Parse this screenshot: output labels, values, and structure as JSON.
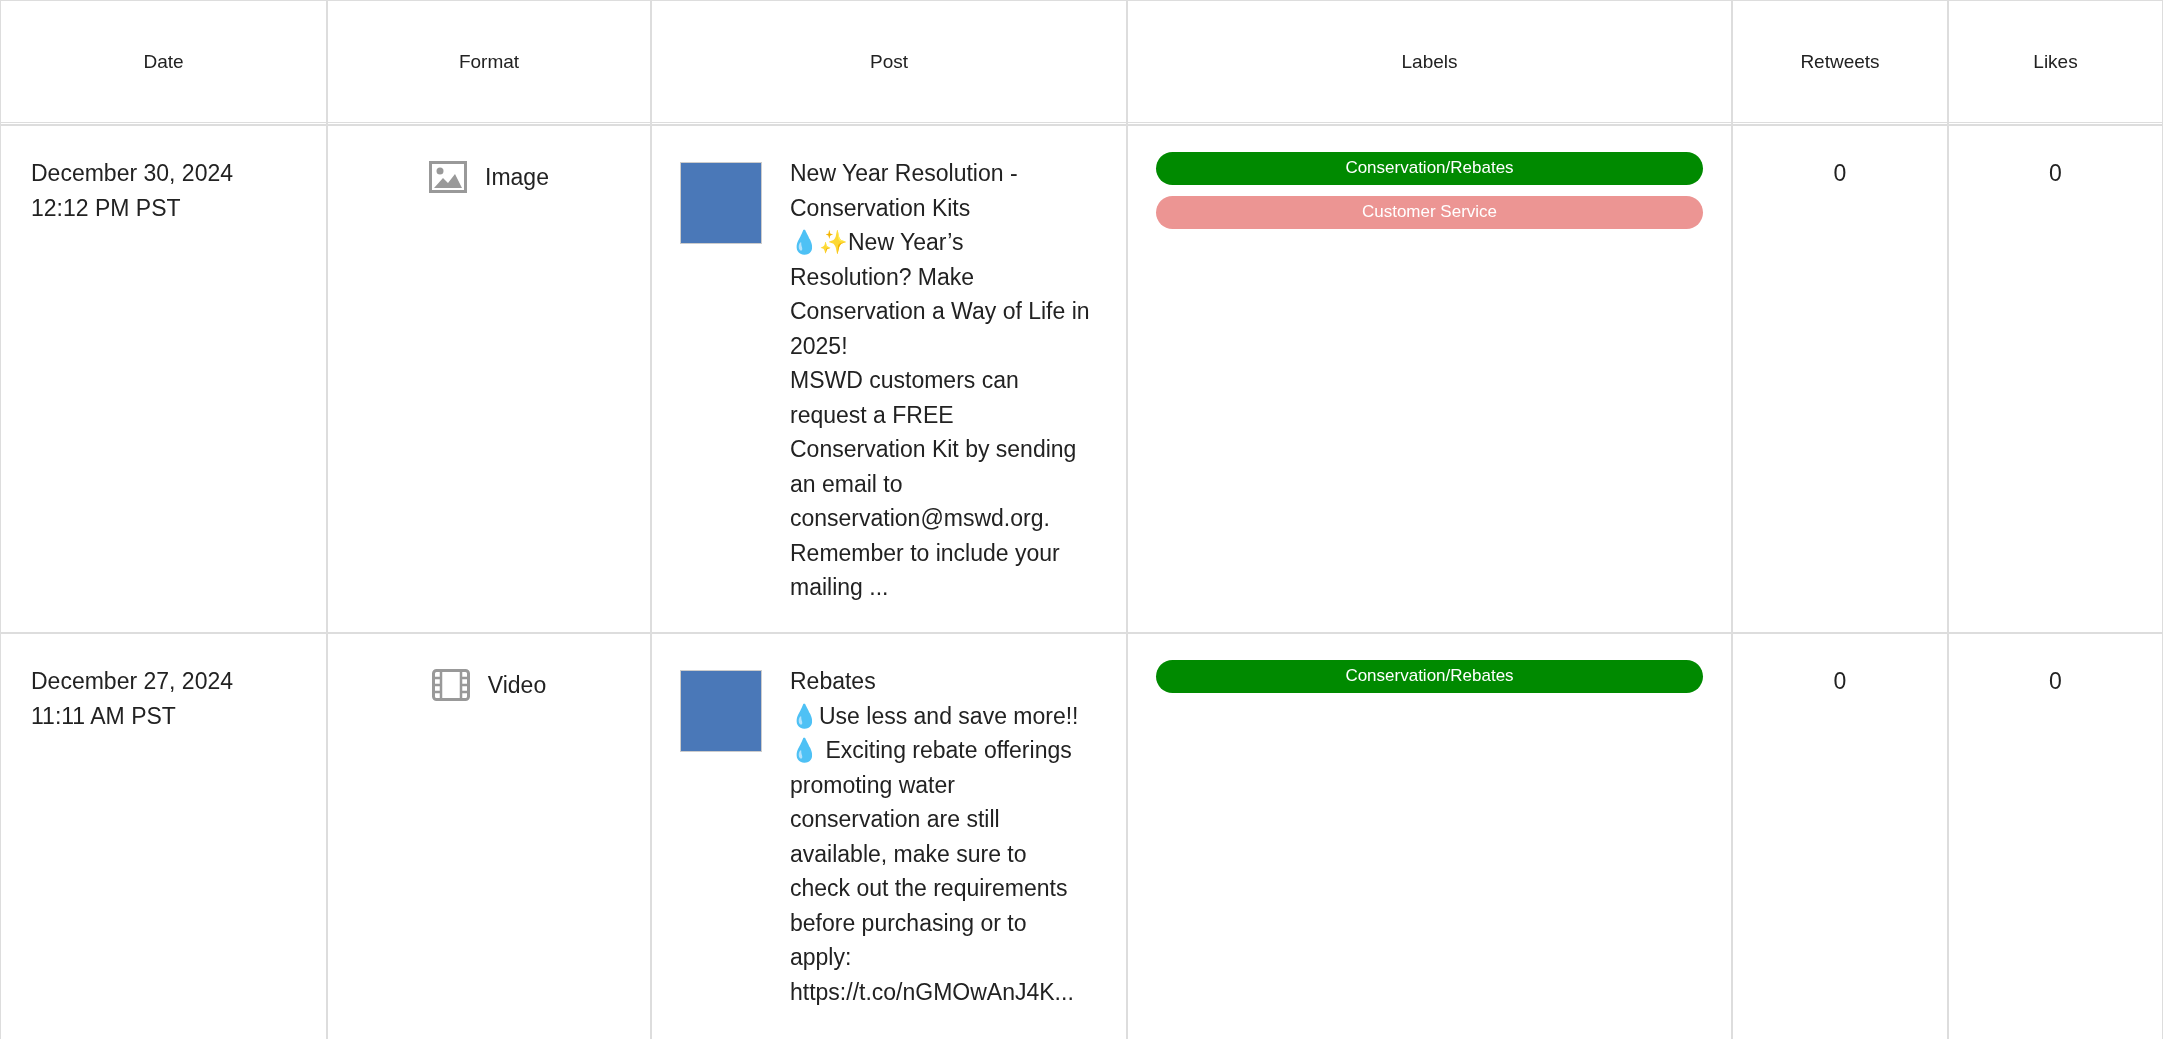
{
  "table": {
    "columns": [
      "Date",
      "Format",
      "Post",
      "Labels",
      "Retweets",
      "Likes"
    ],
    "rows": [
      {
        "date": "December 30, 2024",
        "time": "12:12 PM PST",
        "format": {
          "kind": "image",
          "label": "Image"
        },
        "post": {
          "lines": [
            "New Year Resolution -",
            "Conservation Kits",
            "💧✨New Year’s Resolution? Make Conservation a Way of Life in 2025!",
            "MSWD customers can request a FREE Conservation Kit by sending an email to conservation@mswd.org.",
            "Remember to include your mailing ..."
          ]
        },
        "labels": [
          {
            "text": "Conservation/Rebates",
            "color": "#008a00"
          },
          {
            "text": "Customer Service",
            "color": "#ec9593"
          }
        ],
        "retweets": "0",
        "likes": "0"
      },
      {
        "date": "December 27, 2024",
        "time": "11:11 AM PST",
        "format": {
          "kind": "video",
          "label": "Video"
        },
        "post": {
          "lines": [
            "Rebates",
            "💧Use less and save more!!💧 Exciting rebate offerings promoting water conservation are still available, make sure to check out the requirements before purchasing or to apply:",
            "https://t.co/nGMOwAnJ4K..."
          ]
        },
        "labels": [
          {
            "text": "Conservation/Rebates",
            "color": "#008a00"
          }
        ],
        "retweets": "0",
        "likes": "0"
      }
    ]
  }
}
